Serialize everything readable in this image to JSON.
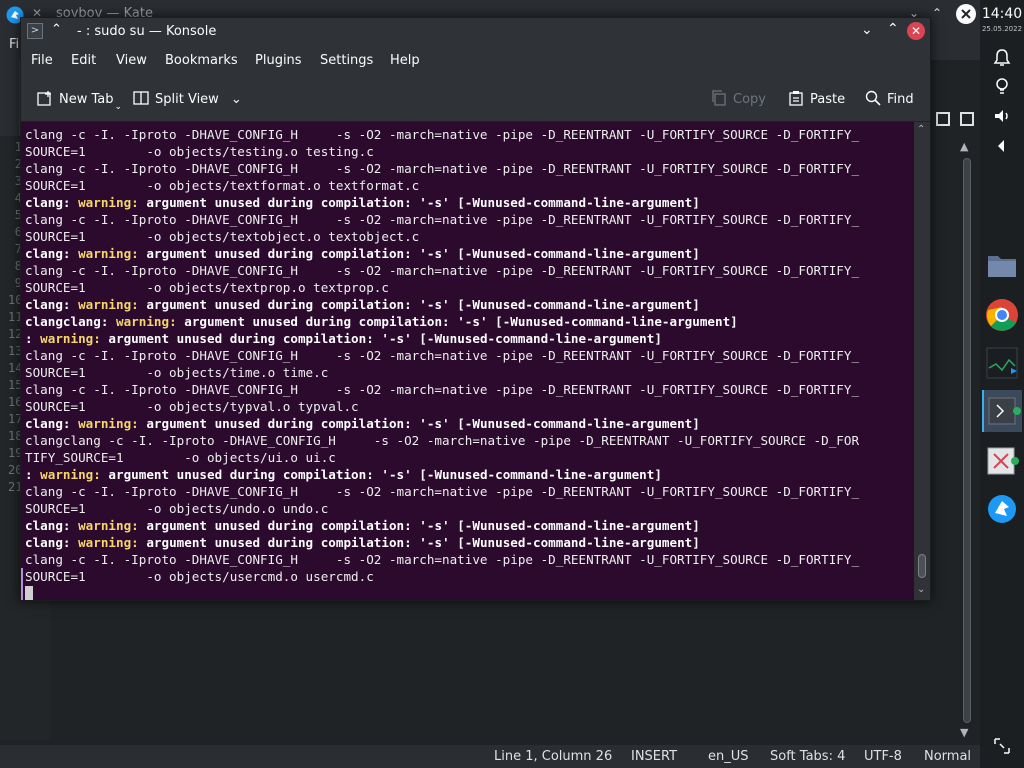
{
  "kate": {
    "title": "soyboy — Kate",
    "menu_first_letter": "Fi",
    "gutter_lines": [
      "1",
      "2",
      "3",
      "4",
      "5",
      "6",
      "7",
      "8",
      "9",
      "10",
      "11",
      "12",
      "13",
      "14",
      "15",
      "16",
      "17",
      "18",
      "19",
      "20",
      "21"
    ],
    "status": {
      "position": "Line 1, Column 26",
      "mode": "INSERT",
      "language": "en_US",
      "tabs": "Soft Tabs: 4",
      "encoding": "UTF-8",
      "view": "Normal"
    }
  },
  "panel": {
    "time": "14:40",
    "date": "25.05.2022"
  },
  "konsole": {
    "title": "- : sudo su — Konsole",
    "menu": [
      "File",
      "Edit",
      "View",
      "Bookmarks",
      "Plugins",
      "Settings",
      "Help"
    ],
    "toolbar": {
      "new_tab": "New Tab",
      "split_view": "Split View",
      "copy": "Copy",
      "paste": "Paste",
      "find": "Find"
    }
  },
  "terminal": {
    "warning_word": "warning:",
    "lines": [
      {
        "type": "plain",
        "text": "clang -c -I. -Iproto -DHAVE_CONFIG_H     -s -O2 -march=native -pipe -D_REENTRANT -U_FORTIFY_SOURCE -D_FORTIFY_"
      },
      {
        "type": "plain",
        "text": "SOURCE=1        -o objects/testing.o testing.c"
      },
      {
        "type": "plain",
        "text": "clang -c -I. -Iproto -DHAVE_CONFIG_H     -s -O2 -march=native -pipe -D_REENTRANT -U_FORTIFY_SOURCE -D_FORTIFY_"
      },
      {
        "type": "plain",
        "text": "SOURCE=1        -o objects/textformat.o textformat.c"
      },
      {
        "type": "warn",
        "prefix": "clang: ",
        "msg": " argument unused during compilation: '-s' [-Wunused-command-line-argument]"
      },
      {
        "type": "plain",
        "text": "clang -c -I. -Iproto -DHAVE_CONFIG_H     -s -O2 -march=native -pipe -D_REENTRANT -U_FORTIFY_SOURCE -D_FORTIFY_"
      },
      {
        "type": "plain",
        "text": "SOURCE=1        -o objects/textobject.o textobject.c"
      },
      {
        "type": "warn",
        "prefix": "clang: ",
        "msg": " argument unused during compilation: '-s' [-Wunused-command-line-argument]"
      },
      {
        "type": "plain",
        "text": "clang -c -I. -Iproto -DHAVE_CONFIG_H     -s -O2 -march=native -pipe -D_REENTRANT -U_FORTIFY_SOURCE -D_FORTIFY_"
      },
      {
        "type": "plain",
        "text": "SOURCE=1        -o objects/textprop.o textprop.c"
      },
      {
        "type": "warn",
        "prefix": "clang: ",
        "msg": " argument unused during compilation: '-s' [-Wunused-command-line-argument]"
      },
      {
        "type": "warn",
        "prefix": "clangclang: ",
        "msg": " argument unused during compilation: '-s' [-Wunused-command-line-argument]"
      },
      {
        "type": "warn",
        "prefix": ": ",
        "msg": " argument unused during compilation: '-s' [-Wunused-command-line-argument]"
      },
      {
        "type": "plain",
        "text": "clang -c -I. -Iproto -DHAVE_CONFIG_H     -s -O2 -march=native -pipe -D_REENTRANT -U_FORTIFY_SOURCE -D_FORTIFY_"
      },
      {
        "type": "plain",
        "text": "SOURCE=1        -o objects/time.o time.c"
      },
      {
        "type": "plain",
        "text": "clang -c -I. -Iproto -DHAVE_CONFIG_H     -s -O2 -march=native -pipe -D_REENTRANT -U_FORTIFY_SOURCE -D_FORTIFY_"
      },
      {
        "type": "plain",
        "text": "SOURCE=1        -o objects/typval.o typval.c"
      },
      {
        "type": "warn",
        "prefix": "clang: ",
        "msg": " argument unused during compilation: '-s' [-Wunused-command-line-argument]"
      },
      {
        "type": "plain",
        "text": "clangclang -c -I. -Iproto -DHAVE_CONFIG_H     -s -O2 -march=native -pipe -D_REENTRANT -U_FORTIFY_SOURCE -D_FOR"
      },
      {
        "type": "plain",
        "text": "TIFY_SOURCE=1        -o objects/ui.o ui.c"
      },
      {
        "type": "warn",
        "prefix": ": ",
        "msg": " argument unused during compilation: '-s' [-Wunused-command-line-argument]"
      },
      {
        "type": "plain",
        "text": "clang -c -I. -Iproto -DHAVE_CONFIG_H     -s -O2 -march=native -pipe -D_REENTRANT -U_FORTIFY_SOURCE -D_FORTIFY_"
      },
      {
        "type": "plain",
        "text": "SOURCE=1        -o objects/undo.o undo.c"
      },
      {
        "type": "warn",
        "prefix": "clang: ",
        "msg": " argument unused during compilation: '-s' [-Wunused-command-line-argument]"
      },
      {
        "type": "warn",
        "prefix": "clang: ",
        "msg": " argument unused during compilation: '-s' [-Wunused-command-line-argument]"
      },
      {
        "type": "plain",
        "text": "clang -c -I. -Iproto -DHAVE_CONFIG_H     -s -O2 -march=native -pipe -D_REENTRANT -U_FORTIFY_SOURCE -D_FORTIFY_"
      },
      {
        "type": "plain",
        "text": "SOURCE=1        -o objects/usercmd.o usercmd.c"
      }
    ]
  },
  "colors": {
    "terminal_bg": "#2b0a2e",
    "warning": "#f6d66a",
    "close": "#da4453",
    "accent": "#3daee9"
  }
}
